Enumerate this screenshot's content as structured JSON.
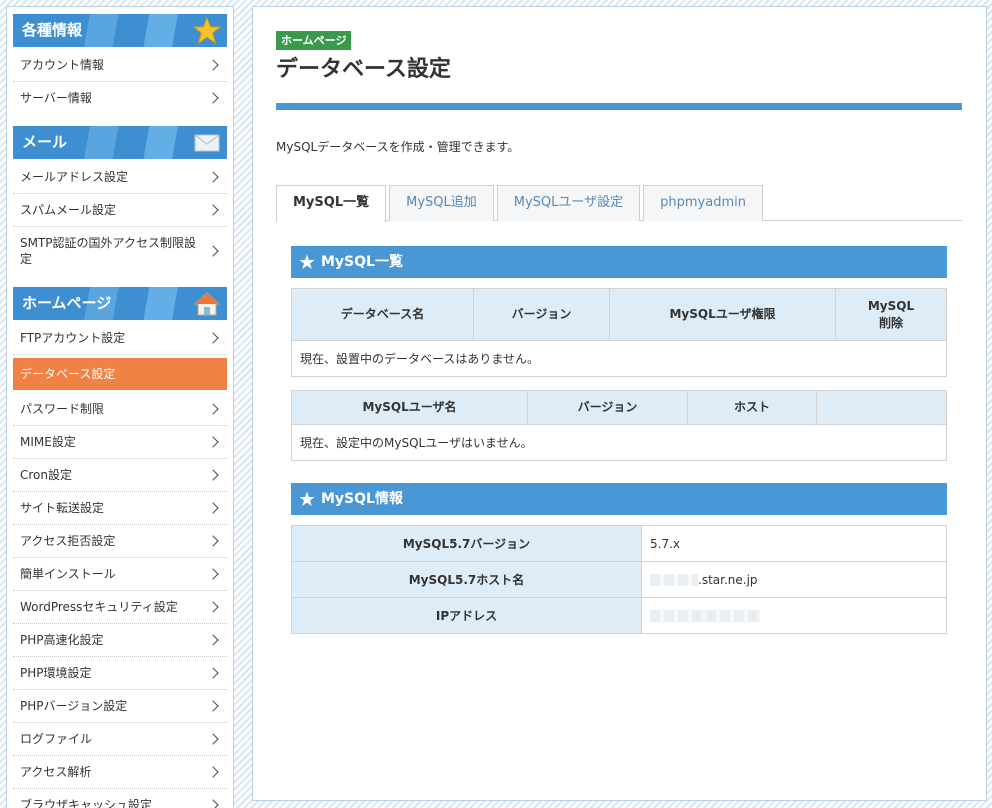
{
  "sidebar": {
    "sections": [
      {
        "title": "各種情報",
        "icon": "star-icon",
        "items": [
          {
            "label": "アカウント情報"
          },
          {
            "label": "サーバー情報"
          }
        ]
      },
      {
        "title": "メール",
        "icon": "envelope-icon",
        "items": [
          {
            "label": "メールアドレス設定"
          },
          {
            "label": "スパムメール設定"
          },
          {
            "label": "SMTP認証の国外アクセス制限設定"
          }
        ]
      },
      {
        "title": "ホームページ",
        "icon": "house-icon",
        "items": [
          {
            "label": "FTPアカウント設定"
          },
          {
            "label": "データベース設定",
            "active": true
          },
          {
            "label": "パスワード制限"
          },
          {
            "label": "MIME設定"
          },
          {
            "label": "Cron設定"
          },
          {
            "label": "サイト転送設定"
          },
          {
            "label": "アクセス拒否設定"
          },
          {
            "label": "簡単インストール"
          },
          {
            "label": "WordPressセキュリティ設定"
          },
          {
            "label": "PHP高速化設定"
          },
          {
            "label": "PHP環境設定"
          },
          {
            "label": "PHPバージョン設定"
          },
          {
            "label": "ログファイル"
          },
          {
            "label": "アクセス解析"
          },
          {
            "label": "ブラウザキャッシュ設定"
          }
        ]
      }
    ]
  },
  "main": {
    "badge": "ホームページ",
    "title": "データベース設定",
    "description": "MySQLデータベースを作成・管理できます。",
    "tabs": [
      {
        "label": "MySQL一覧",
        "active": true
      },
      {
        "label": "MySQL追加"
      },
      {
        "label": "MySQLユーザ設定"
      },
      {
        "label": "phpmyadmin"
      }
    ],
    "list_section": {
      "title": "MySQL一覧",
      "db_table": {
        "headers": [
          "データベース名",
          "バージョン",
          "MySQLユーザ権限",
          "MySQL\n削除"
        ],
        "empty_message": "現在、設置中のデータベースはありません。"
      },
      "user_table": {
        "headers": [
          "MySQLユーザ名",
          "バージョン",
          "ホスト",
          ""
        ],
        "empty_message": "現在、設定中のMySQLユーザはいません。"
      }
    },
    "info_section": {
      "title": "MySQL情報",
      "rows": [
        {
          "key": "MySQL5.7バージョン",
          "value": "5.7.x"
        },
        {
          "key": "MySQL5.7ホスト名",
          "value": ".star.ne.jp"
        },
        {
          "key": "IPアドレス",
          "value": ""
        }
      ]
    }
  },
  "colors": {
    "accent_blue": "#4a97d6",
    "active_orange": "#f08245",
    "badge_green": "#3a9a4c",
    "header_cell": "#deecf8"
  }
}
